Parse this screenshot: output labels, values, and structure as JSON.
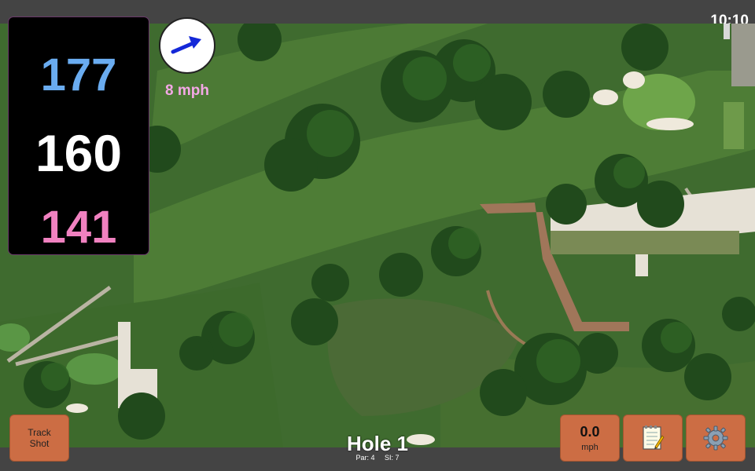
{
  "status": {
    "time": "10:10"
  },
  "distances": {
    "back": "177",
    "middle": "160",
    "front": "141"
  },
  "wind": {
    "speed": "8 mph",
    "direction_icon": "arrow-icon"
  },
  "hole": {
    "title": "Hole 1",
    "par": "Par: 4",
    "stroke_index": "SI: 7"
  },
  "buttons": {
    "track_shot_line1": "Track",
    "track_shot_line2": "Shot",
    "speed_value": "0.0",
    "speed_unit": "mph",
    "notes_icon": "notepad-icon",
    "settings_icon": "gear-icon"
  },
  "colors": {
    "back_distance": "#6aacf0",
    "middle_distance": "#ffffff",
    "front_distance": "#f081c0",
    "button_bg": "#cc6d44",
    "wind_text": "#f4a8e6"
  }
}
